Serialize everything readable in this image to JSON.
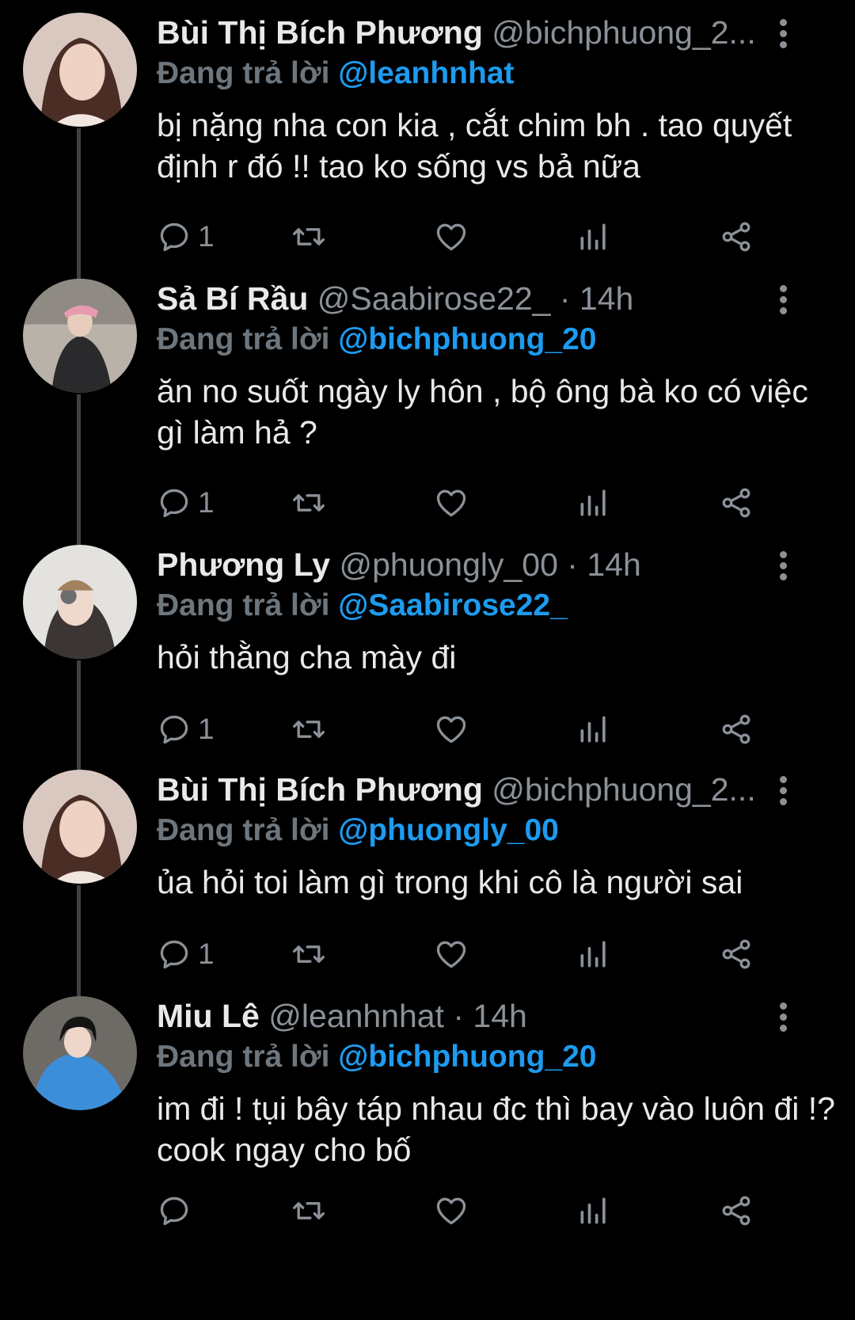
{
  "labels": {
    "replying_to": "Đang trả lời"
  },
  "tweets": [
    {
      "name": "Bùi Thị Bích Phương",
      "handle": "@bichphuong_2...",
      "meta": "",
      "reply_to": "@leanhnhat",
      "text": "bị nặng nha con kia , cắt chim bh . tao quyết định r đó !! tao ko sống vs bả nữa",
      "reply_count": "1"
    },
    {
      "name": "Sả Bí Rầu",
      "handle": "@Saabirose22_",
      "meta": " · 14h",
      "reply_to": "@bichphuong_20",
      "text": "ăn no suốt ngày ly hôn , bộ ông bà ko có việc gì làm hả ?",
      "reply_count": "1"
    },
    {
      "name": "Phương Ly",
      "handle": "@phuongly_00",
      "meta": " · 14h",
      "reply_to": "@Saabirose22_",
      "text": "hỏi thằng cha mày đi",
      "reply_count": "1"
    },
    {
      "name": "Bùi Thị Bích Phương",
      "handle": "@bichphuong_2...",
      "meta": "",
      "reply_to": "@phuongly_00",
      "text": "ủa hỏi toi làm gì trong khi cô là người sai",
      "reply_count": "1"
    },
    {
      "name": "Miu Lê",
      "handle": "@leanhnhat",
      "meta": " · 14h",
      "reply_to": "@bichphuong_20",
      "text": "im đi ! tụi bây táp nhau đc thì bay vào luôn đi !? cook ngay cho bố",
      "reply_count": ""
    }
  ],
  "colors": {
    "link": "#1d9bf0",
    "muted": "#8b9198",
    "text": "#e7e9ea",
    "background": "#000000"
  },
  "icons": [
    "reply-icon",
    "retweet-icon",
    "like-icon",
    "views-icon",
    "share-icon",
    "more-icon"
  ]
}
